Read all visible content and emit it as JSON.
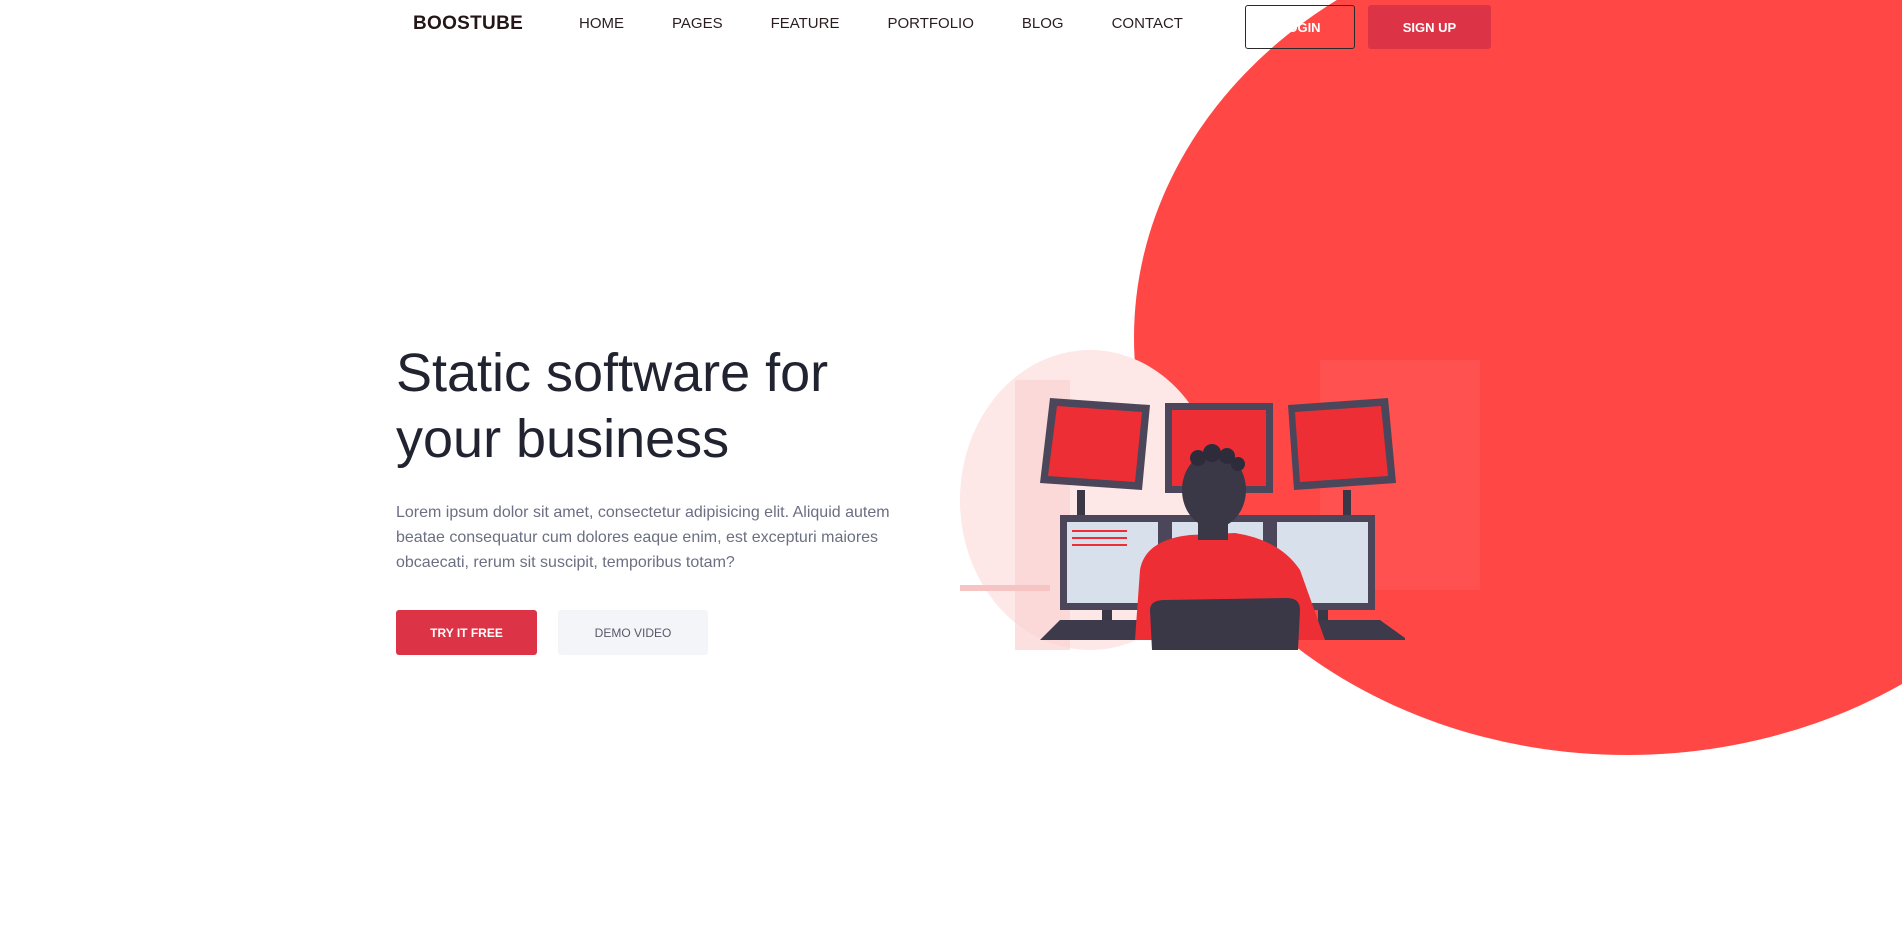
{
  "brand": {
    "name": "BOOSTUBE"
  },
  "nav": {
    "links": [
      "HOME",
      "PAGES",
      "FEATURE",
      "PORTFOLIO",
      "BLOG",
      "CONTACT"
    ],
    "login_label": "LOGIN",
    "signup_label": "SIGN UP"
  },
  "hero": {
    "title_line1": "Static software for",
    "title_line2": "your business",
    "description": "Lorem ipsum dolor sit amet, consectetur adipisicing elit. Aliquid autem beatae consequatur cum dolores eaque enim, est excepturi maiores obcaecati, rerum sit suscipit, temporibus totam?",
    "primary_button": "TRY IT FREE",
    "secondary_button": "DEMO VIDEO"
  },
  "colors": {
    "accent": "#ff4846",
    "button_red": "#dd3346",
    "heading": "#212430",
    "body_text": "#6b6f82"
  },
  "illustration": {
    "icon": "person-at-monitors-illustration"
  }
}
